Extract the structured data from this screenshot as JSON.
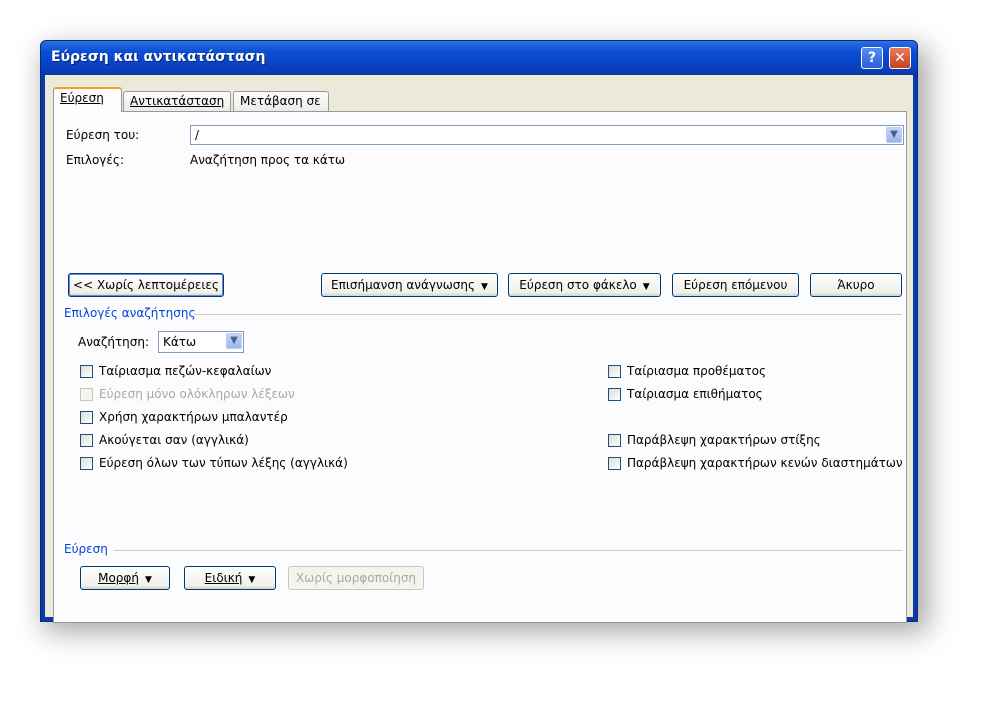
{
  "window": {
    "title": "Εύρεση και αντικατάσταση",
    "help_label": "?",
    "close_label": "✕"
  },
  "tabs": [
    {
      "label": "Εύρεση",
      "active": true
    },
    {
      "label": "Αντικατάσταση",
      "active": false
    },
    {
      "label": "Μετάβαση σε",
      "active": false
    }
  ],
  "find": {
    "label": "Εύρεση του:",
    "value": "/",
    "options_label": "Επιλογές:",
    "options_value": "Αναζήτηση προς τα κάτω"
  },
  "buttons": {
    "less": "<< Χωρίς λεπτομέρειες",
    "highlight": "Επισήμανση ανάγνωσης",
    "find_in": "Εύρεση στο φάκελο",
    "find_next": "Εύρεση επόμενου",
    "cancel": "Άκυρο"
  },
  "search_options": {
    "title": "Επιλογές αναζήτησης",
    "search_label": "Αναζήτηση:",
    "search_value": "Κάτω",
    "left_checks": [
      {
        "label": "Ταίριασμα πεζών-κεφαλαίων",
        "checked": false,
        "disabled": false
      },
      {
        "label": "Εύρεση μόνο ολόκληρων λέξεων",
        "checked": false,
        "disabled": true
      },
      {
        "label": "Χρήση χαρακτήρων μπαλαντέρ",
        "checked": false,
        "disabled": false
      },
      {
        "label": "Ακούγεται σαν (αγγλικά)",
        "checked": false,
        "disabled": false
      },
      {
        "label": "Εύρεση όλων των τύπων λέξης (αγγλικά)",
        "checked": false,
        "disabled": false
      }
    ],
    "right_checks": [
      {
        "label": "Ταίριασμα προθέματος",
        "checked": false,
        "disabled": false
      },
      {
        "label": "Ταίριασμα επιθήματος",
        "checked": false,
        "disabled": false
      },
      {
        "label": "Παράβλεψη χαρακτήρων στίξης",
        "checked": false,
        "disabled": false
      },
      {
        "label": "Παράβλεψη χαρακτήρων κενών διαστημάτων",
        "checked": false,
        "disabled": false
      }
    ]
  },
  "find_group": {
    "title": "Εύρεση",
    "format": "Μορφή",
    "special": "Ειδική",
    "no_format": "Χωρίς μορφοποίηση"
  },
  "icons": {
    "dropdown": "chevron-down-icon",
    "menu_arrow": "triangle-down-icon"
  }
}
